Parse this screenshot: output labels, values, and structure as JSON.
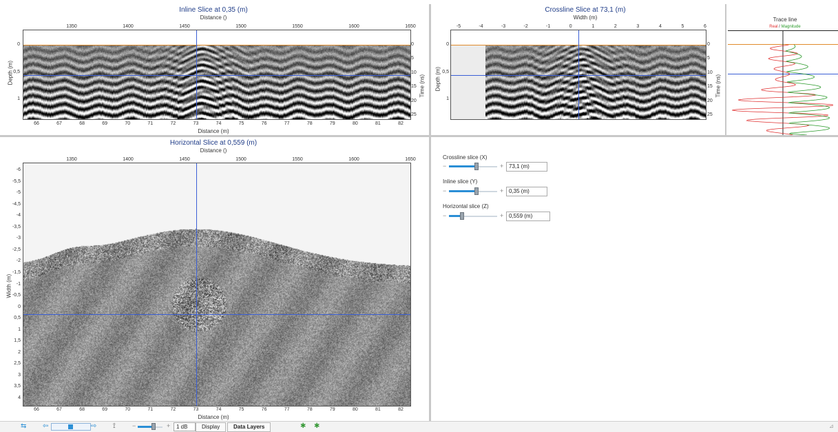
{
  "inline": {
    "title": "Inline Slice at 0,35 (m)",
    "top_axis_label": "Distance ()",
    "top_ticks": [
      "1350",
      "1400",
      "1450",
      "1500",
      "1550",
      "1600",
      "1650"
    ],
    "bottom_axis_label": "Distance (m)",
    "bottom_ticks": [
      "66",
      "67",
      "68",
      "69",
      "70",
      "71",
      "72",
      "73",
      "74",
      "75",
      "76",
      "77",
      "78",
      "79",
      "80",
      "81",
      "82"
    ],
    "left_axis_label": "Depth (m)",
    "left_ticks": [
      "0",
      "0,5",
      "1"
    ],
    "right_axis_label": "Time (ns)",
    "right_ticks": [
      "0",
      "5",
      "10",
      "15",
      "20",
      "25"
    ]
  },
  "crossline": {
    "title": "Crossline Slice at 73,1 (m)",
    "top_axis_label": "Width (m)",
    "top_ticks": [
      "-5",
      "-4",
      "-3",
      "-2",
      "-1",
      "0",
      "1",
      "2",
      "3",
      "4",
      "5",
      "6"
    ],
    "left_axis_label": "Depth (m)",
    "left_ticks": [
      "0",
      "0,5",
      "1"
    ],
    "right_axis_label": "Time (ns)",
    "right_ticks": [
      "0",
      "5",
      "10",
      "15",
      "20",
      "25"
    ]
  },
  "trace": {
    "title": "Trace line",
    "legend_real": "Real",
    "legend_sep": " / ",
    "legend_mag": "Magnitude",
    "real_color": "#e03030",
    "mag_color": "#2a9a2a"
  },
  "horizontal": {
    "title": "Horizontal Slice at 0,559 (m)",
    "top_axis_label": "Distance ()",
    "top_ticks": [
      "1350",
      "1400",
      "1450",
      "1500",
      "1550",
      "1600",
      "1650"
    ],
    "bottom_axis_label": "Distance (m)",
    "bottom_ticks": [
      "66",
      "67",
      "68",
      "69",
      "70",
      "71",
      "72",
      "73",
      "74",
      "75",
      "76",
      "77",
      "78",
      "79",
      "80",
      "81",
      "82"
    ],
    "left_axis_label": "Width (m)",
    "left_ticks": [
      "-6",
      "-5,5",
      "-5",
      "-4,5",
      "-4",
      "-3,5",
      "-3",
      "-2,5",
      "-2",
      "-1,5",
      "-1",
      "-0,5",
      "0",
      "0,5",
      "1",
      "1,5",
      "2",
      "2,5",
      "3",
      "3,5",
      "4"
    ]
  },
  "controls": {
    "crossline": {
      "label": "Crossline slice (X)",
      "value": "73,1 (m)",
      "position": 0.55
    },
    "inline": {
      "label": "Inline slice (Y)",
      "value": "0,35 (m)",
      "position": 0.55
    },
    "horizontal": {
      "label": "Horizontal slice (Z)",
      "value": "0,559 (m)",
      "position": 0.25
    },
    "minus": "−",
    "plus": "+"
  },
  "toolbar": {
    "gain_value": "1 dB",
    "gain_position": 0.6,
    "display_label": "Display",
    "data_layers_label": "Data Layers",
    "minus": "−",
    "plus": "+"
  },
  "colors": {
    "title": "#1f3c88",
    "crosshair": "#3b5fd6",
    "surface_line": "#e08a2a",
    "accent": "#2b8fd6"
  }
}
